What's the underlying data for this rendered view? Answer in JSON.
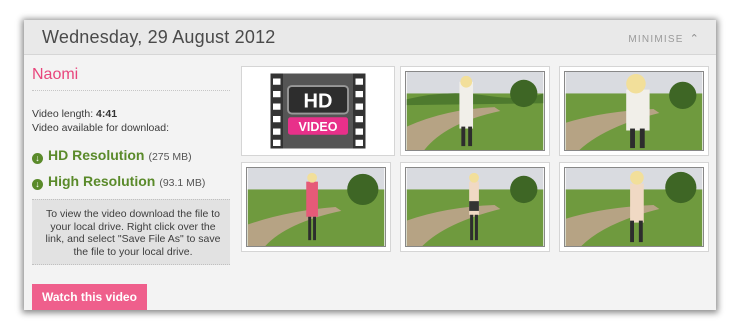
{
  "header": {
    "date": "Wednesday, 29 August 2012",
    "minimise_label": "MINIMISE"
  },
  "model": {
    "name": "Naomi"
  },
  "video": {
    "length_label": "Video length:",
    "length_value": "4:41",
    "download_note": "Video available for download:",
    "downloads": [
      {
        "label": "HD Resolution",
        "size": "(275 MB)",
        "icon": "download-arrow-icon"
      },
      {
        "label": "High Resolution",
        "size": "(93.1 MB)",
        "icon": "download-arrow-icon"
      }
    ],
    "instructions": "To view the video download the file to your local drive. Right click over the link, and select \"Save File As\" to save the file to your local drive.",
    "watch_button": "Watch this video"
  },
  "hd_badge": {
    "hd": "HD",
    "video": "VIDEO",
    "icon": "film-strip-icon"
  },
  "colors": {
    "accent_pink": "#ef5f8c",
    "name_pink": "#e8457c",
    "download_green": "#5a8a2a"
  }
}
